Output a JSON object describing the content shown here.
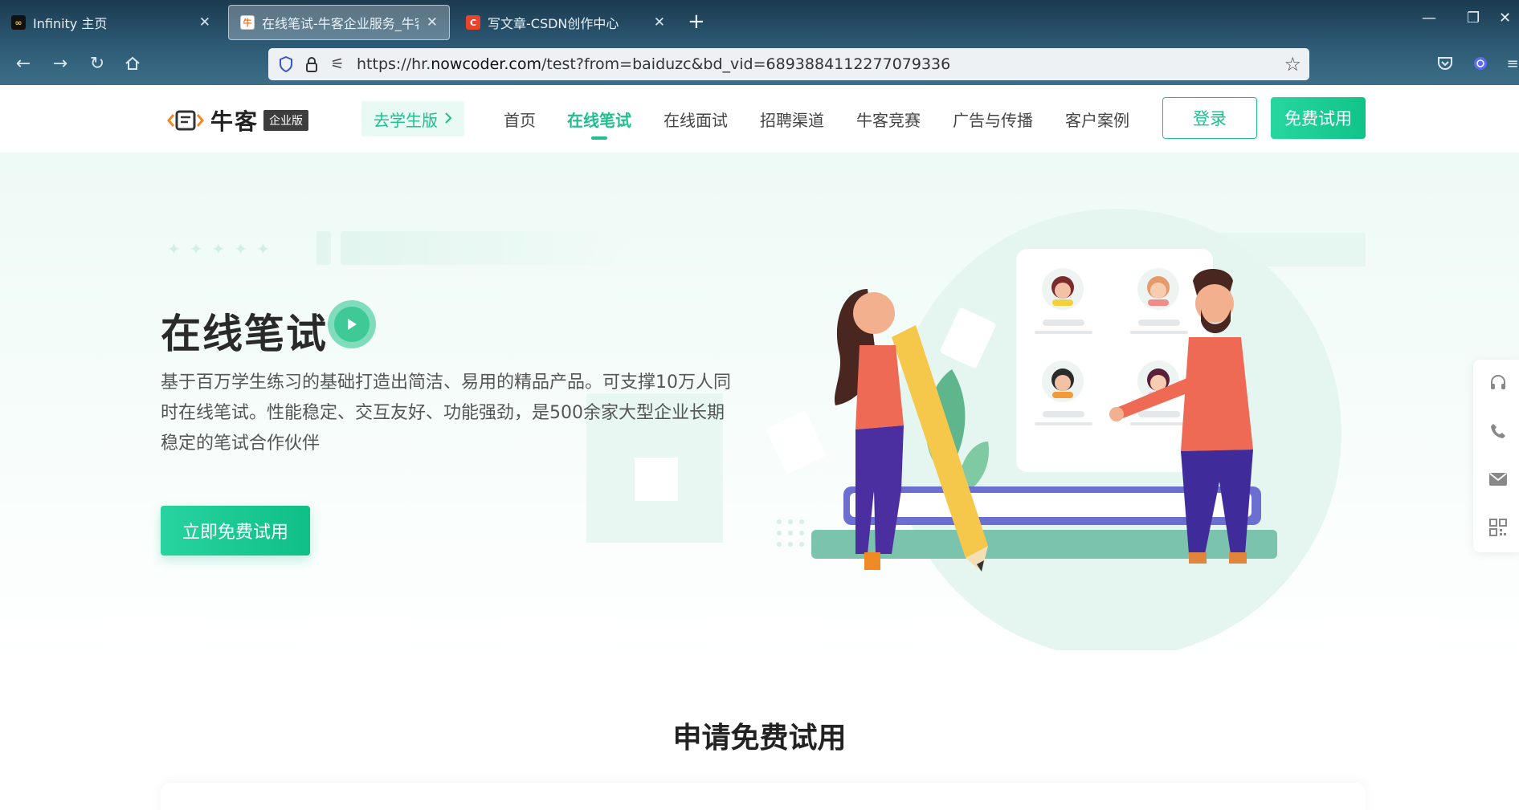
{
  "browser": {
    "tabs": [
      {
        "title": "Infinity 主页",
        "favicon": "infinity-icon",
        "active": false
      },
      {
        "title": "在线笔试-牛客企业服务_牛客",
        "favicon": "nowcoder-icon",
        "active": true
      },
      {
        "title": "写文章-CSDN创作中心",
        "favicon": "csdn-icon",
        "active": false
      }
    ],
    "url": {
      "prefix": "https://hr.",
      "host": "nowcoder.com",
      "rest": "/test?from=baiduzc&bd_vid=6893884112277079336"
    }
  },
  "header": {
    "logo_text": "牛客",
    "logo_badge": "企业版",
    "student_button": "去学生版",
    "nav": [
      "首页",
      "在线笔试",
      "在线面试",
      "招聘渠道",
      "牛客竞赛",
      "广告与传播",
      "客户案例"
    ],
    "active_nav_index": 1,
    "login": "登录",
    "free_trial": "免费试用"
  },
  "hero": {
    "title": "在线笔试",
    "description": "基于百万学生练习的基础打造出简洁、易用的精品产品。可支撑10万人同时在线笔试。性能稳定、交互友好、功能强劲，是500余家大型企业长期稳定的笔试合作伙伴",
    "cta": "立即免费试用"
  },
  "sidebar_icons": [
    "headset-icon",
    "phone-icon",
    "mail-icon",
    "qrcode-icon"
  ],
  "apply": {
    "title": "申请免费试用"
  },
  "colors": {
    "brand_green": "#1fbf8f",
    "hero_bg": "#eefaf6"
  }
}
